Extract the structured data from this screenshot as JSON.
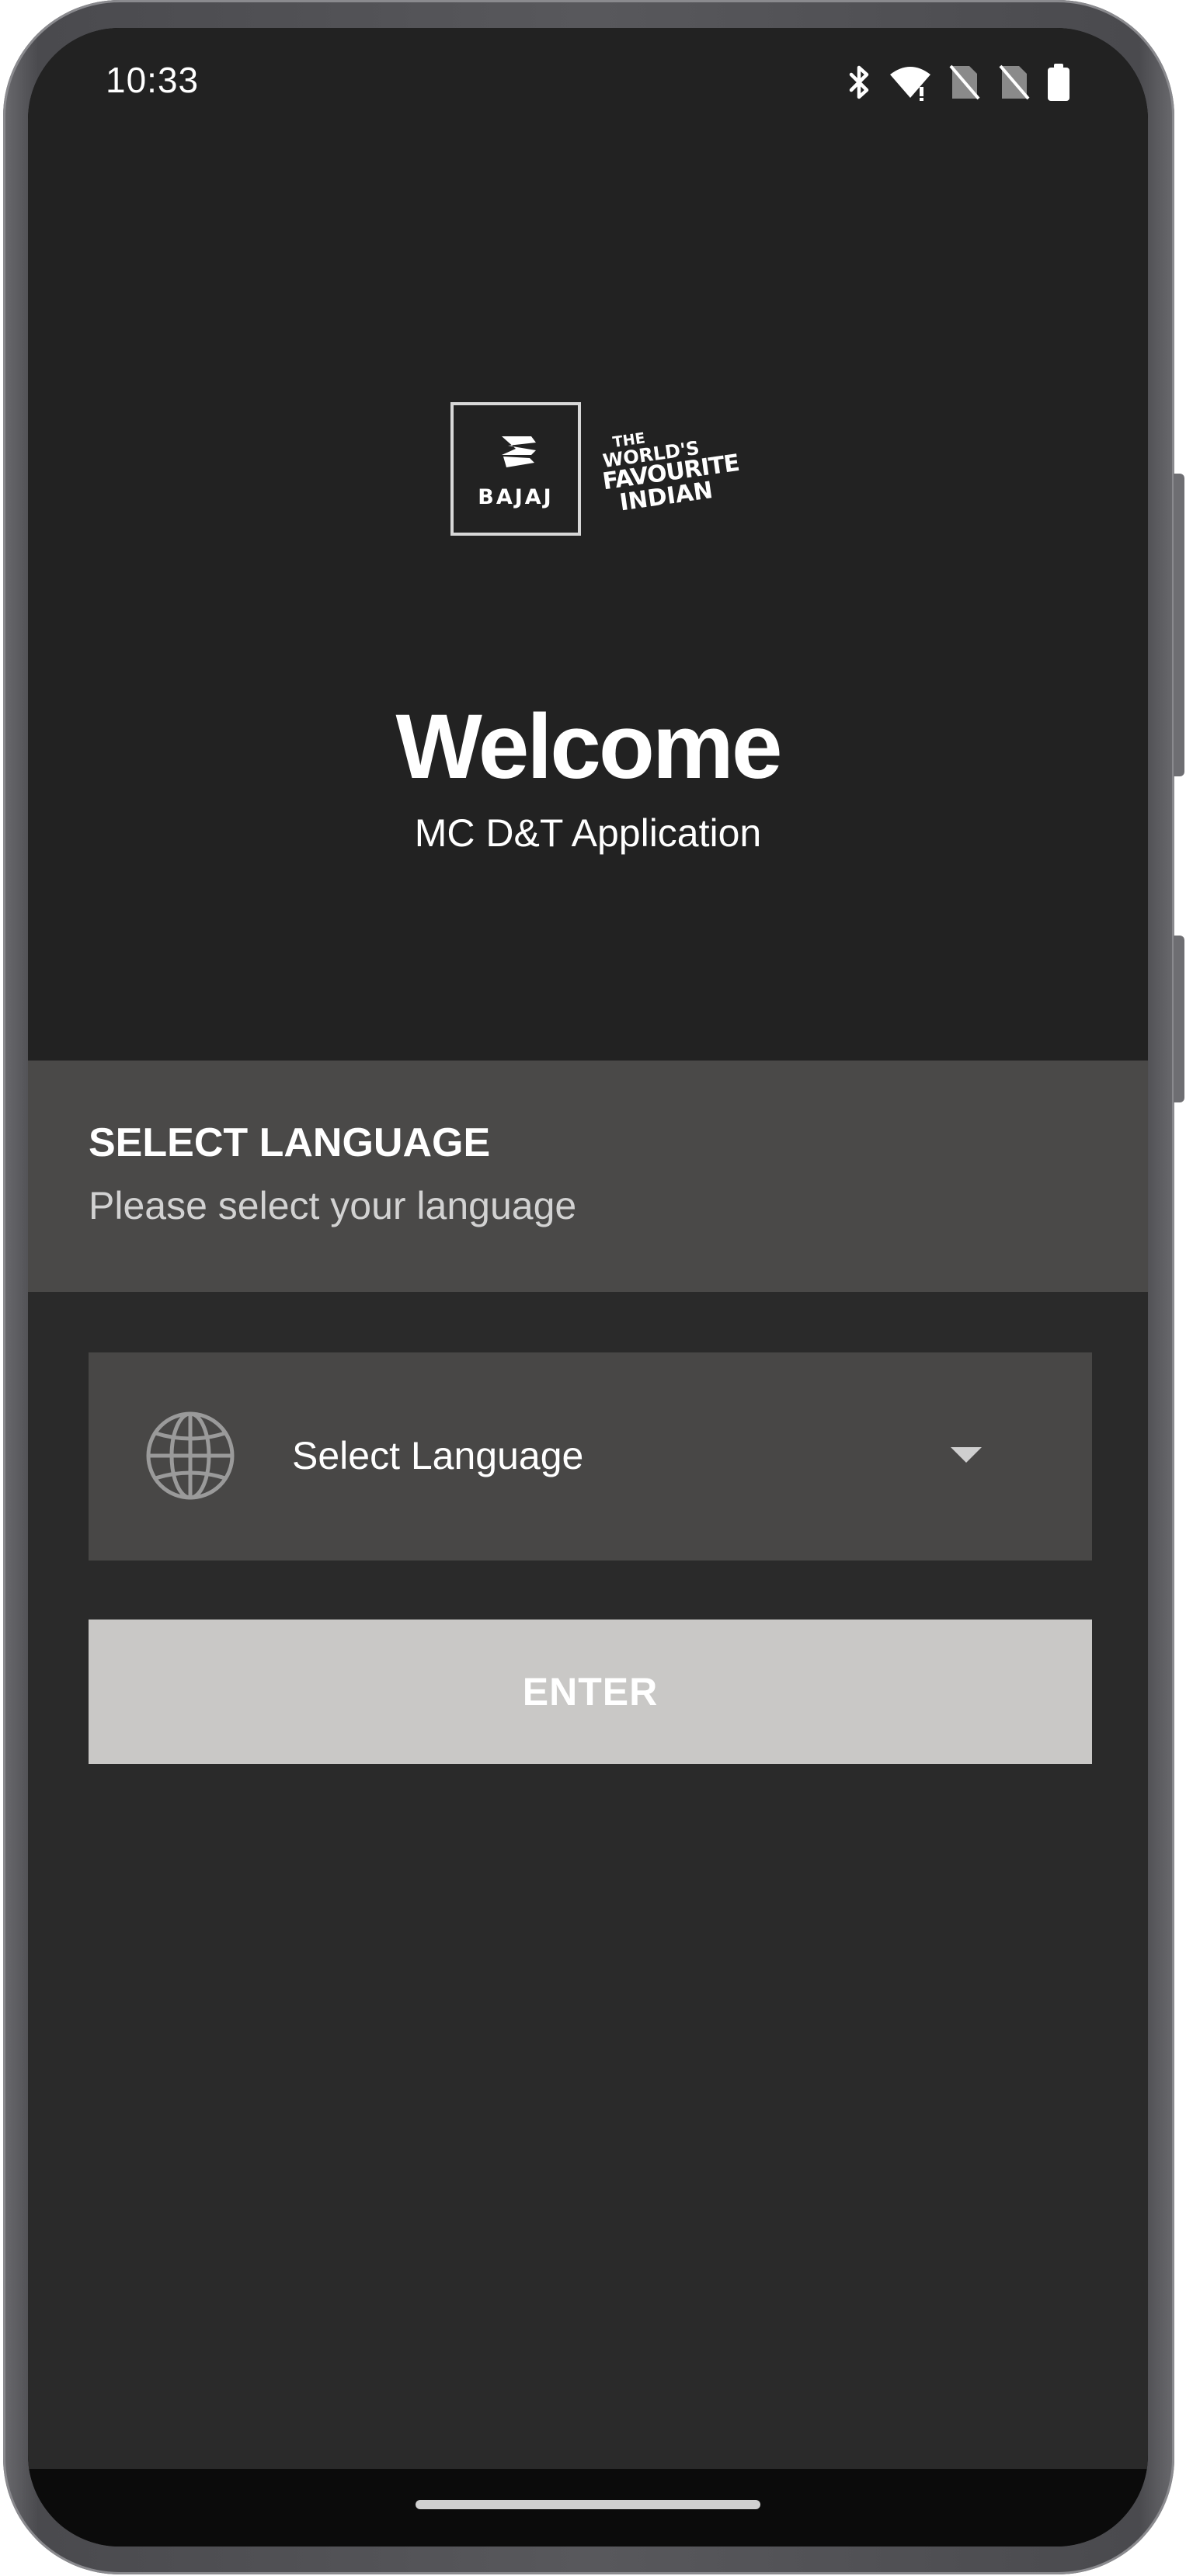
{
  "status_bar": {
    "time": "10:33",
    "icons": [
      "bluetooth-icon",
      "wifi-icon",
      "no-sim-icon",
      "no-sim-icon",
      "battery-icon"
    ]
  },
  "brand": {
    "logo_text": "BAJAJ",
    "tagline_small": "THE",
    "tagline_line1": "WORLD'S",
    "tagline_line2": "FAVOURITE",
    "tagline_line3": "INDIAN"
  },
  "hero": {
    "title": "Welcome",
    "subtitle": "MC D&T Application"
  },
  "language_section": {
    "title": "SELECT LANGUAGE",
    "description": "Please select your language"
  },
  "language_dropdown": {
    "icon": "globe-icon",
    "selected": "Select Language",
    "caret_icon": "caret-down-icon"
  },
  "enter_button": {
    "label": "ENTER"
  },
  "colors": {
    "top_background": "#222222",
    "section_background": "#4a4948",
    "bottom_background": "#2a2a2a",
    "dropdown_background": "#484746",
    "button_background": "#c9c8c6",
    "text": "#ffffff"
  }
}
